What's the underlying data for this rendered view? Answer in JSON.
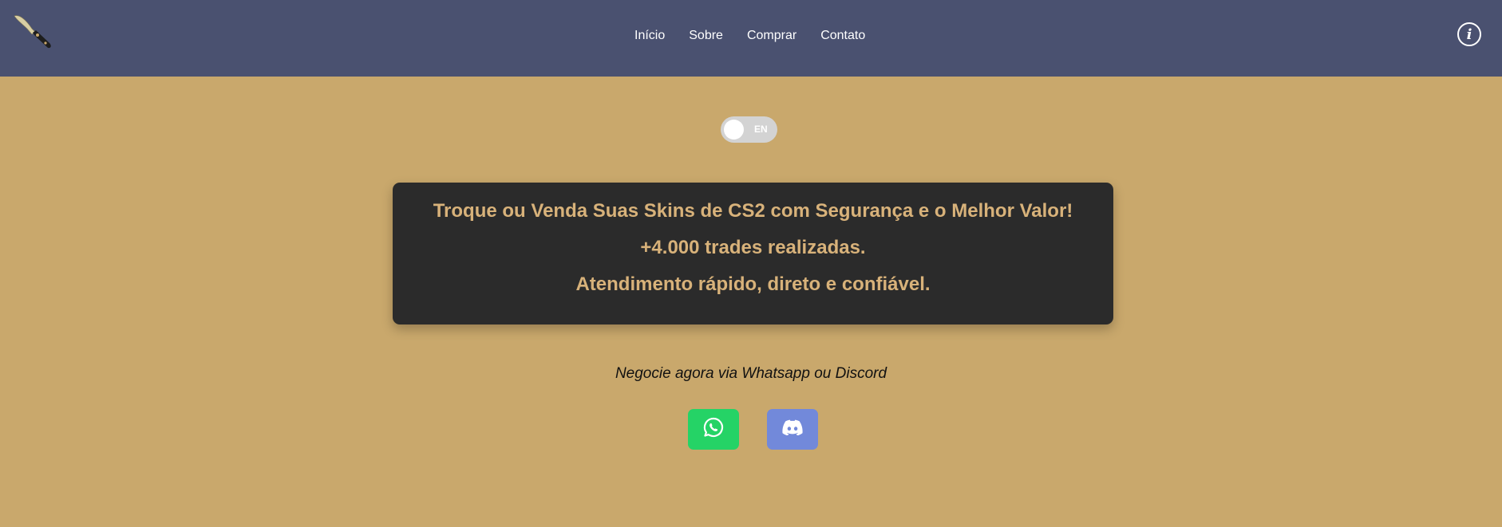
{
  "nav": {
    "links": [
      "Início",
      "Sobre",
      "Comprar",
      "Contato"
    ],
    "info_icon": "info-icon",
    "logo_icon": "knife-logo-icon"
  },
  "language_toggle": {
    "label": "EN",
    "state": "off"
  },
  "hero": {
    "line1": "Troque ou Venda Suas Skins de CS2 com Segurança e o Melhor Valor!",
    "line2": "+4.000 trades realizadas.",
    "line3": "Atendimento rápido, direto e confiável."
  },
  "cta": {
    "text": "Negocie agora via Whatsapp ou Discord"
  },
  "social": {
    "whatsapp_icon": "whatsapp-icon",
    "discord_icon": "discord-icon"
  },
  "colors": {
    "navbar": "#4a5170",
    "background": "#c9a86c",
    "card": "#2b2b2b",
    "card_text": "#d8b27a",
    "whatsapp": "#25d366",
    "discord": "#7289da"
  }
}
